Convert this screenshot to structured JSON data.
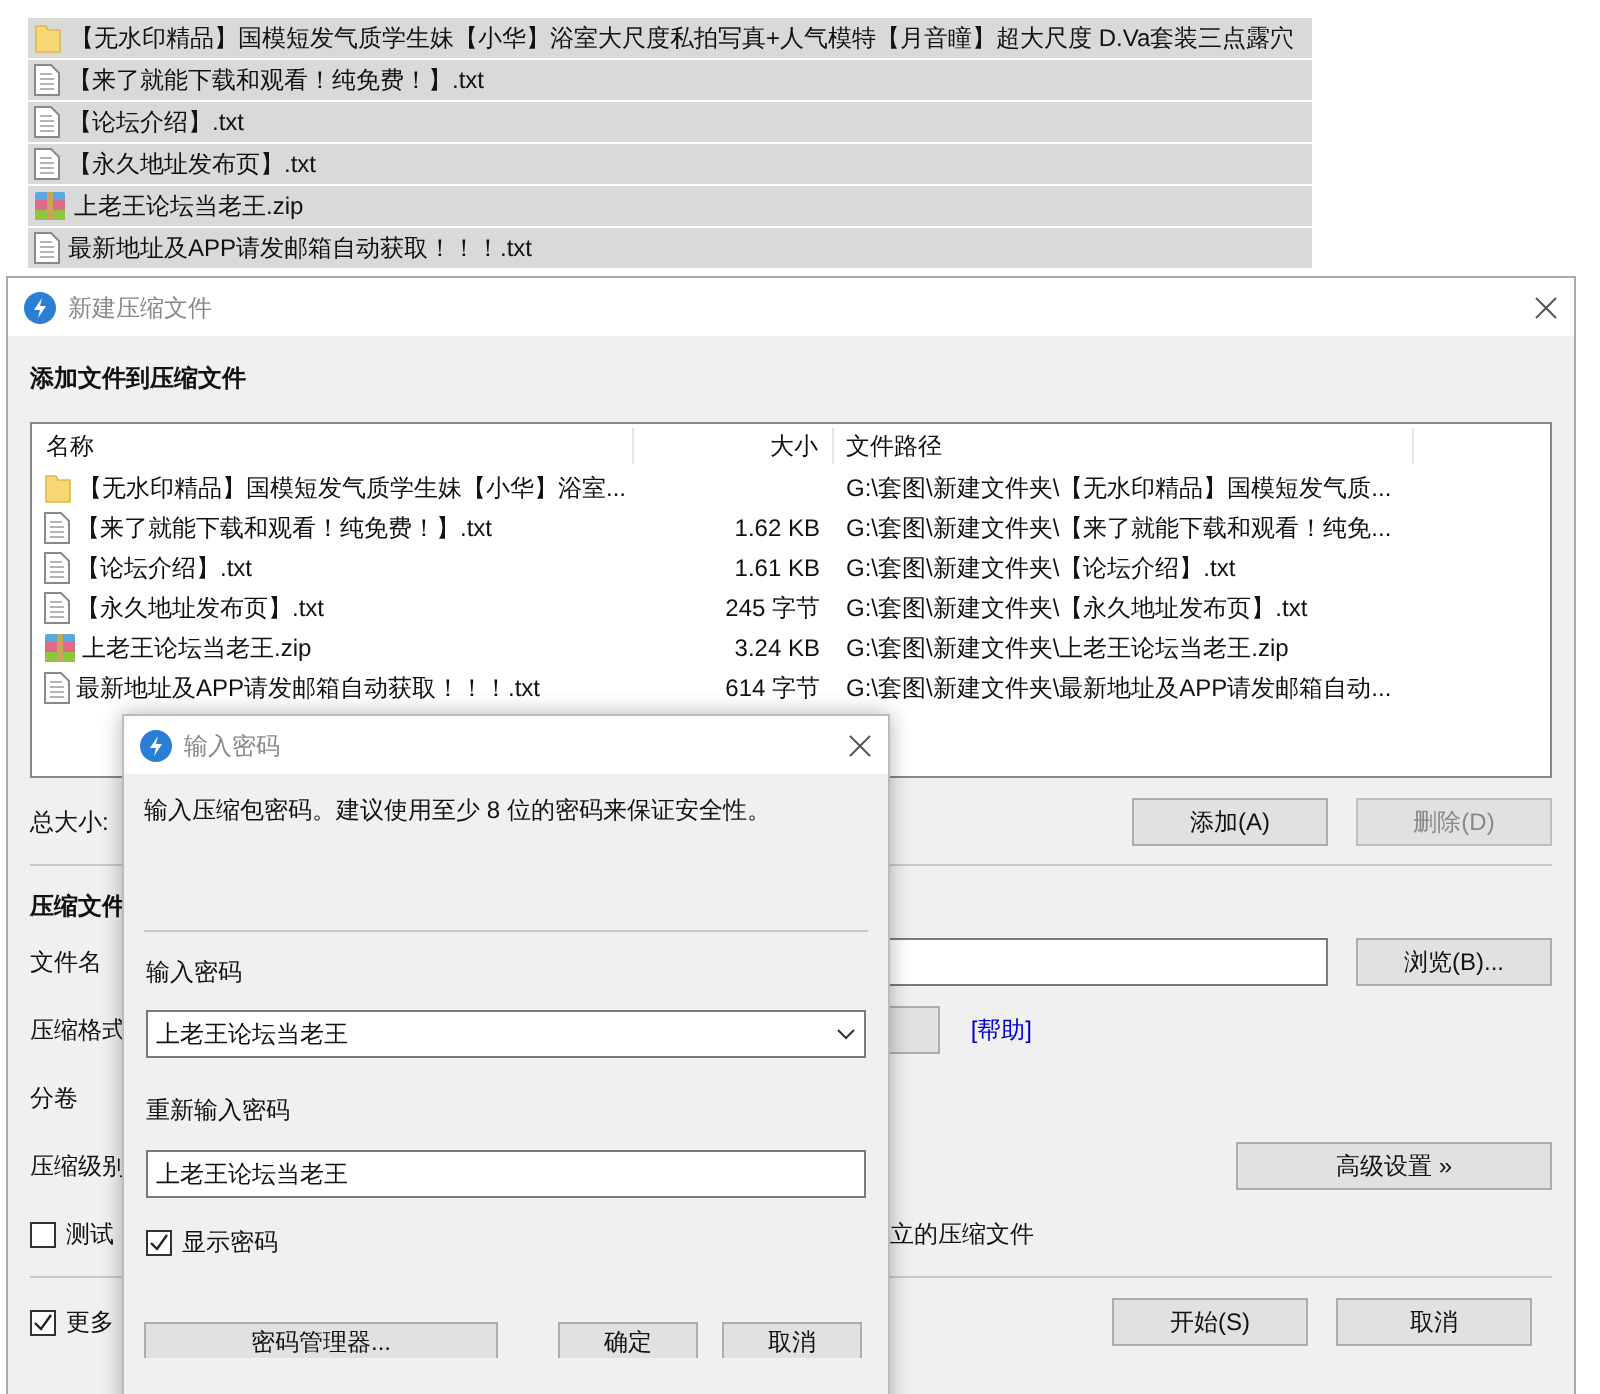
{
  "background_files": [
    {
      "kind": "folder",
      "name": "【无水印精品】国模短发气质学生妹【小华】浴室大尺度私拍写真+人气模特【月音瞳】超大尺度 D.Va套装三点露穴"
    },
    {
      "kind": "txt",
      "name": "【来了就能下载和观看！纯免费！】.txt"
    },
    {
      "kind": "txt",
      "name": "【论坛介绍】.txt"
    },
    {
      "kind": "txt",
      "name": "【永久地址发布页】.txt"
    },
    {
      "kind": "zip",
      "name": "上老王论坛当老王.zip"
    },
    {
      "kind": "txt",
      "name": "最新地址及APP请发邮箱自动获取！！！.txt"
    }
  ],
  "main_window": {
    "title": "新建压缩文件",
    "heading": "添加文件到压缩文件",
    "columns": [
      "名称",
      "大小",
      "文件路径"
    ],
    "files": [
      {
        "kind": "folder",
        "name": "【无水印精品】国模短发气质学生妹【小华】浴室...",
        "path": "G:\\套图\\新建文件夹\\【无水印精品】国模短发气质..."
      },
      {
        "kind": "txt",
        "name": "【来了就能下载和观看！纯免费！】.txt",
        "size": "1.62 KB",
        "path": "G:\\套图\\新建文件夹\\【来了就能下载和观看！纯免..."
      },
      {
        "kind": "txt",
        "name": "【论坛介绍】.txt",
        "size": "1.61 KB",
        "path": "G:\\套图\\新建文件夹\\【论坛介绍】.txt"
      },
      {
        "kind": "txt",
        "name": "【永久地址发布页】.txt",
        "size": "245 字节",
        "path": "G:\\套图\\新建文件夹\\【永久地址发布页】.txt"
      },
      {
        "kind": "zip",
        "name": "上老王论坛当老王.zip",
        "size": "3.24 KB",
        "path": "G:\\套图\\新建文件夹\\上老王论坛当老王.zip"
      },
      {
        "kind": "txt",
        "name": "最新地址及APP请发邮箱自动获取！！！.txt",
        "size": "614 字节",
        "path": "G:\\套图\\新建文件夹\\最新地址及APP请发邮箱自动..."
      }
    ],
    "total": "总大小:",
    "list_buttons": [
      {
        "label": "添加(A)",
        "disabled": false
      },
      {
        "label": "删除(D)",
        "disabled": true
      }
    ],
    "section": "压缩文件",
    "filename_label": "文件名",
    "browse": "浏览(B)...",
    "format_label": "压缩格式",
    "help_link": "[帮助]",
    "split_label": "分卷",
    "level_label": "压缩级别",
    "advanced": "高级设置 »",
    "test_option": {
      "label": "测试",
      "checked": false
    },
    "separate_text": "立的压缩文件",
    "more_option": {
      "label": "更多",
      "checked": true
    },
    "bottom_buttons": [
      "开始(S)",
      "取消"
    ]
  },
  "password_dialog": {
    "title": "输入密码",
    "hint": "输入压缩包密码。建议使用至少 8 位的密码来保证安全性。",
    "password_label": "输入密码",
    "password": "上老王论坛当老王",
    "repeat_label": "重新输入密码",
    "repeat": "上老王论坛当老王",
    "show_password": {
      "label": "显示密码",
      "checked": true
    },
    "buttons": [
      "密码管理器...",
      "确定",
      "取消"
    ]
  }
}
